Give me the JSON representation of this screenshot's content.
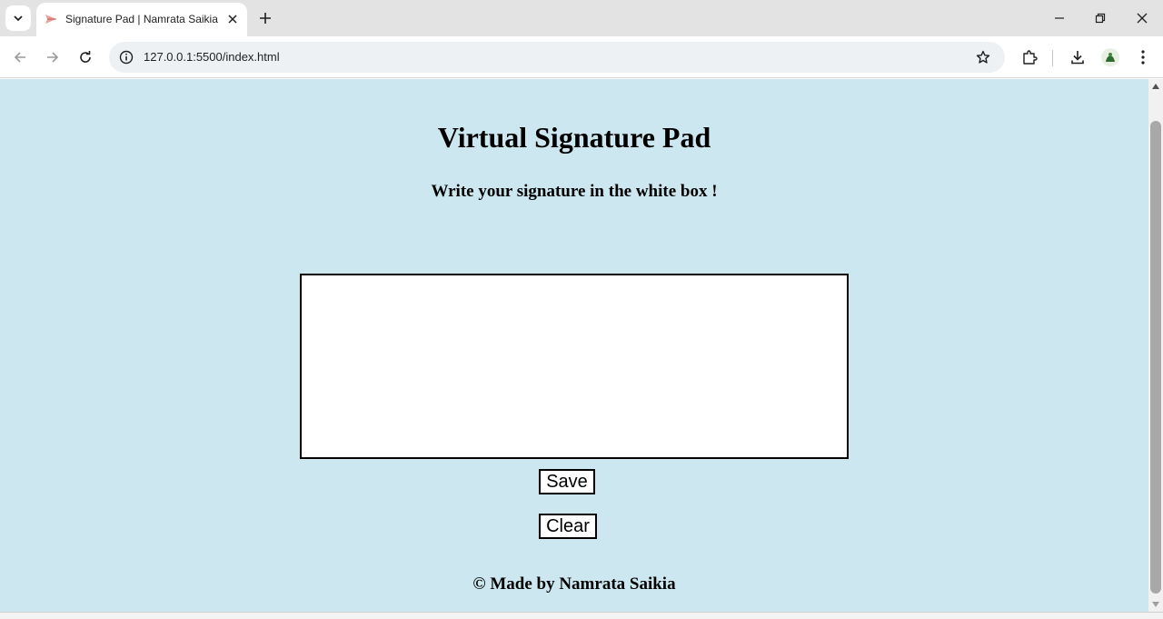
{
  "browser": {
    "tab": {
      "title": "Signature Pad | Namrata Saikia"
    },
    "address_bar": {
      "url": "127.0.0.1:5500/index.html"
    },
    "icons": {
      "tab_search": "chevron-down-icon",
      "favicon": "paper-plane-icon",
      "tab_close": "close-icon",
      "new_tab": "plus-icon",
      "minimize": "minimize-icon",
      "restore": "restore-icon",
      "close_window": "close-icon",
      "back": "arrow-left-icon",
      "forward": "arrow-right-icon",
      "reload": "reload-icon",
      "site_info": "info-icon",
      "bookmark": "star-icon",
      "extensions": "puzzle-icon",
      "downloads": "download-icon",
      "profile": "avatar-icon",
      "menu": "kebab-menu-icon"
    }
  },
  "page": {
    "title": "Virtual Signature Pad",
    "subtitle": "Write your signature in the white box !",
    "buttons": {
      "save": "Save",
      "clear": "Clear"
    },
    "footer": "© Made by Namrata Saikia"
  },
  "colors": {
    "page_background": "#cce7f0",
    "signature_box": "#ffffff",
    "border": "#000000"
  }
}
